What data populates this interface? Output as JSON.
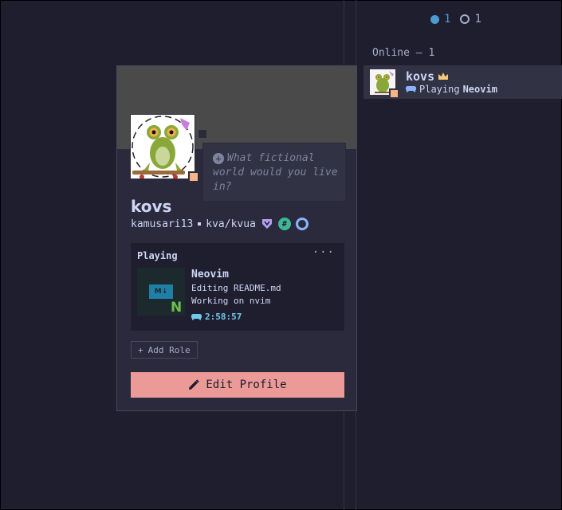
{
  "member_counts": {
    "primary": "1",
    "secondary": "1"
  },
  "members": {
    "header": "Online — 1",
    "list": [
      {
        "name": "kovs",
        "activity_prefix": "Playing",
        "activity_name": "Neovim"
      }
    ]
  },
  "profile": {
    "custom_status_placeholder": "What fictional world would you live in?",
    "display_name": "kovs",
    "username": "kamusari13",
    "pronouns": "kva/kvua",
    "activity": {
      "heading": "Playing",
      "name": "Neovim",
      "details": "Editing README.md",
      "state": "Working on nvim",
      "elapsed": "2:58:57",
      "icon_label": "M↓",
      "icon_mark": "N"
    },
    "add_role_label": "Add Role",
    "edit_profile_label": "Edit Profile"
  },
  "colors": {
    "background": "#1e1e2e",
    "popup": "#2a2a3c",
    "banner": "#4a4a4a",
    "accent_button": "#eb9a98",
    "status_idle": "#fab387",
    "online_dot": "#4a9bd1"
  }
}
